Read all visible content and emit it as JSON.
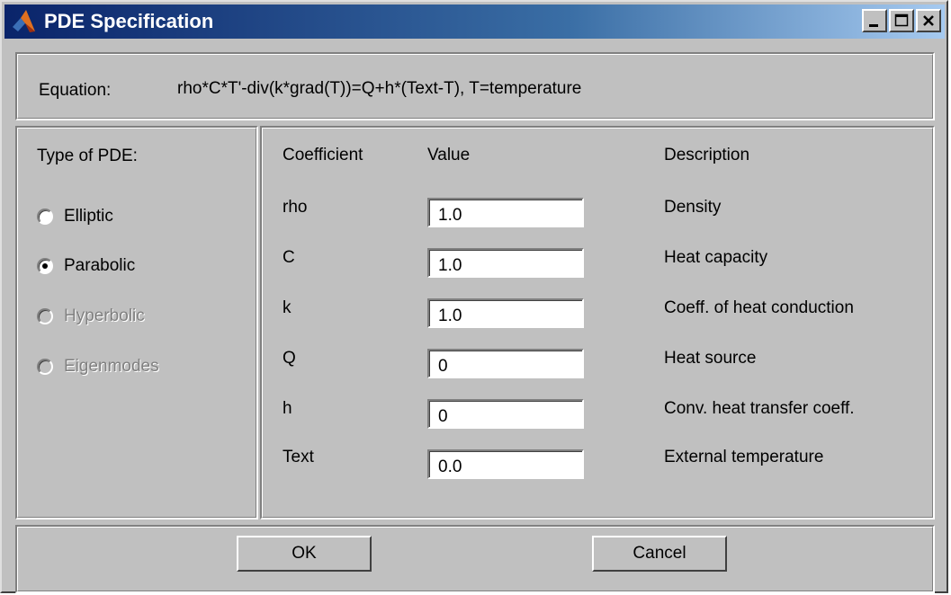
{
  "window": {
    "title": "PDE Specification",
    "controls": {
      "minimize": "minimize-icon",
      "maximize": "maximize-icon",
      "close": "close-icon"
    }
  },
  "equation": {
    "label": "Equation:",
    "text": "rho*C*T'-div(k*grad(T))=Q+h*(Text-T), T=temperature"
  },
  "pde_type": {
    "label": "Type of PDE:",
    "options": [
      {
        "label": "Elliptic",
        "selected": false,
        "enabled": true
      },
      {
        "label": "Parabolic",
        "selected": true,
        "enabled": true
      },
      {
        "label": "Hyperbolic",
        "selected": false,
        "enabled": false
      },
      {
        "label": "Eigenmodes",
        "selected": false,
        "enabled": false
      }
    ]
  },
  "table": {
    "headers": {
      "coefficient": "Coefficient",
      "value": "Value",
      "description": "Description"
    },
    "rows": [
      {
        "coefficient": "rho",
        "value": "1.0",
        "description": "Density"
      },
      {
        "coefficient": "C",
        "value": "1.0",
        "description": "Heat capacity"
      },
      {
        "coefficient": "k",
        "value": "1.0",
        "description": "Coeff. of heat conduction"
      },
      {
        "coefficient": "Q",
        "value": "0",
        "description": "Heat source"
      },
      {
        "coefficient": "h",
        "value": "0",
        "description": "Conv. heat transfer coeff."
      },
      {
        "coefficient": "Text",
        "value": "0.0",
        "description": "External temperature"
      }
    ]
  },
  "buttons": {
    "ok": "OK",
    "cancel": "Cancel"
  },
  "colors": {
    "titlebar_start": "#0a246a",
    "titlebar_end": "#a6caf0",
    "face": "#c0c0c0"
  }
}
